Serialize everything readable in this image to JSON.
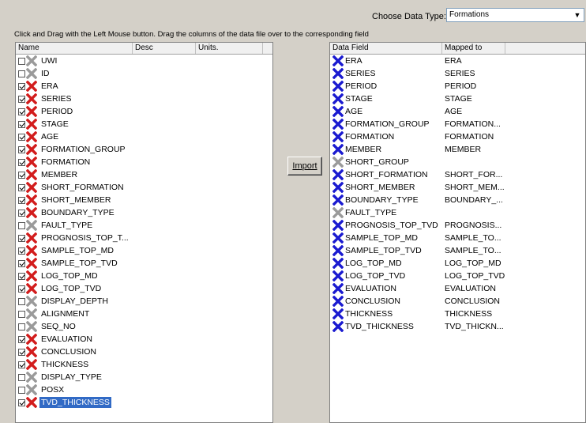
{
  "toolbar": {
    "choose_label": "Choose Data Type:",
    "data_type_value": "Formations"
  },
  "instructions": "Click and Drag with the Left Mouse button. Drag the columns of the data file over to the corresponding field",
  "import_label": "Import",
  "colors": {
    "red_x": "#d21c1c",
    "blue_x": "#1a1ad0",
    "gray_x": "#9a9a9a",
    "selection": "#316ac5"
  },
  "left": {
    "columns": [
      "Name",
      "Desc",
      "Units."
    ],
    "rows": [
      {
        "name": "UWI",
        "checked": false,
        "icon": "gray"
      },
      {
        "name": "ID",
        "checked": false,
        "icon": "gray"
      },
      {
        "name": "ERA",
        "checked": true,
        "icon": "red"
      },
      {
        "name": "SERIES",
        "checked": true,
        "icon": "red"
      },
      {
        "name": "PERIOD",
        "checked": true,
        "icon": "red"
      },
      {
        "name": "STAGE",
        "checked": true,
        "icon": "red"
      },
      {
        "name": "AGE",
        "checked": true,
        "icon": "red"
      },
      {
        "name": "FORMATION_GROUP",
        "checked": true,
        "icon": "red"
      },
      {
        "name": "FORMATION",
        "checked": true,
        "icon": "red"
      },
      {
        "name": "MEMBER",
        "checked": true,
        "icon": "red"
      },
      {
        "name": "SHORT_FORMATION",
        "checked": true,
        "icon": "red"
      },
      {
        "name": "SHORT_MEMBER",
        "checked": true,
        "icon": "red"
      },
      {
        "name": "BOUNDARY_TYPE",
        "checked": true,
        "icon": "red"
      },
      {
        "name": "FAULT_TYPE",
        "checked": false,
        "icon": "gray"
      },
      {
        "name": "PROGNOSIS_TOP_T...",
        "checked": true,
        "icon": "red"
      },
      {
        "name": "SAMPLE_TOP_MD",
        "checked": true,
        "icon": "red"
      },
      {
        "name": "SAMPLE_TOP_TVD",
        "checked": true,
        "icon": "red"
      },
      {
        "name": "LOG_TOP_MD",
        "checked": true,
        "icon": "red"
      },
      {
        "name": "LOG_TOP_TVD",
        "checked": true,
        "icon": "red"
      },
      {
        "name": "DISPLAY_DEPTH",
        "checked": false,
        "icon": "gray"
      },
      {
        "name": "ALIGNMENT",
        "checked": false,
        "icon": "gray"
      },
      {
        "name": "SEQ_NO",
        "checked": false,
        "icon": "gray"
      },
      {
        "name": "EVALUATION",
        "checked": true,
        "icon": "red"
      },
      {
        "name": "CONCLUSION",
        "checked": true,
        "icon": "red"
      },
      {
        "name": "THICKNESS",
        "checked": true,
        "icon": "red"
      },
      {
        "name": "DISPLAY_TYPE",
        "checked": false,
        "icon": "gray"
      },
      {
        "name": "POSX",
        "checked": false,
        "icon": "gray"
      },
      {
        "name": "TVD_THICKNESS",
        "checked": true,
        "icon": "red",
        "selected": true
      }
    ]
  },
  "right": {
    "columns": [
      "Data Field",
      "Mapped to"
    ],
    "rows": [
      {
        "field": "ERA",
        "mapped": "ERA",
        "icon": "blue"
      },
      {
        "field": "SERIES",
        "mapped": "SERIES",
        "icon": "blue"
      },
      {
        "field": "PERIOD",
        "mapped": "PERIOD",
        "icon": "blue"
      },
      {
        "field": "STAGE",
        "mapped": "STAGE",
        "icon": "blue"
      },
      {
        "field": "AGE",
        "mapped": "AGE",
        "icon": "blue"
      },
      {
        "field": "FORMATION_GROUP",
        "mapped": "FORMATION...",
        "icon": "blue"
      },
      {
        "field": "FORMATION",
        "mapped": "FORMATION",
        "icon": "blue"
      },
      {
        "field": "MEMBER",
        "mapped": "MEMBER",
        "icon": "blue"
      },
      {
        "field": "SHORT_GROUP",
        "mapped": "",
        "icon": "gray"
      },
      {
        "field": "SHORT_FORMATION",
        "mapped": "SHORT_FOR...",
        "icon": "blue"
      },
      {
        "field": "SHORT_MEMBER",
        "mapped": "SHORT_MEM...",
        "icon": "blue"
      },
      {
        "field": "BOUNDARY_TYPE",
        "mapped": "BOUNDARY_...",
        "icon": "blue"
      },
      {
        "field": "FAULT_TYPE",
        "mapped": "",
        "icon": "gray"
      },
      {
        "field": "PROGNOSIS_TOP_TVD",
        "mapped": "PROGNOSIS...",
        "icon": "blue"
      },
      {
        "field": "SAMPLE_TOP_MD",
        "mapped": "SAMPLE_TO...",
        "icon": "blue"
      },
      {
        "field": "SAMPLE_TOP_TVD",
        "mapped": "SAMPLE_TO...",
        "icon": "blue"
      },
      {
        "field": "LOG_TOP_MD",
        "mapped": "LOG_TOP_MD",
        "icon": "blue"
      },
      {
        "field": "LOG_TOP_TVD",
        "mapped": "LOG_TOP_TVD",
        "icon": "blue"
      },
      {
        "field": "EVALUATION",
        "mapped": "EVALUATION",
        "icon": "blue"
      },
      {
        "field": "CONCLUSION",
        "mapped": "CONCLUSION",
        "icon": "blue"
      },
      {
        "field": "THICKNESS",
        "mapped": "THICKNESS",
        "icon": "blue"
      },
      {
        "field": "TVD_THICKNESS",
        "mapped": "TVD_THICKN...",
        "icon": "blue"
      }
    ]
  }
}
